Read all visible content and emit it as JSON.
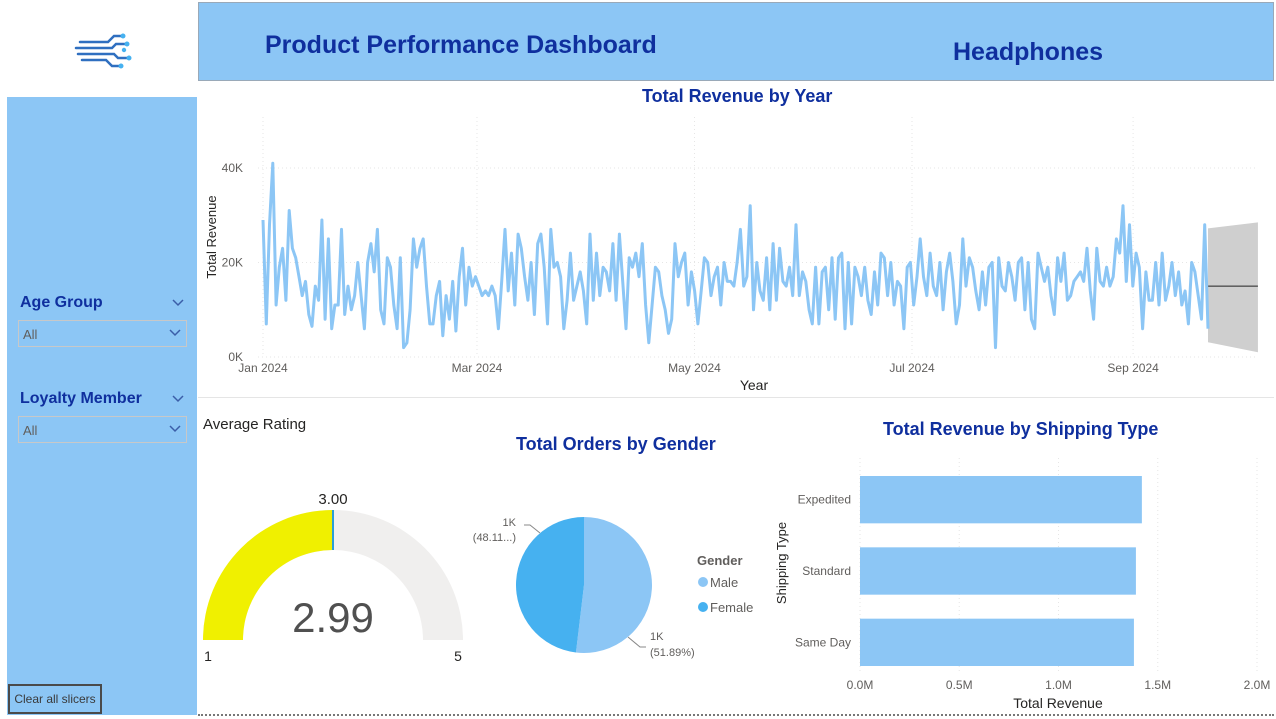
{
  "header": {
    "title": "Product Performance Dashboard",
    "product": "Headphones"
  },
  "slicers": [
    {
      "title": "Age Group",
      "value": "All"
    },
    {
      "title": "Loyalty Member",
      "value": "All"
    }
  ],
  "clear_button": "Clear all slicers",
  "colors": {
    "panel": "#8cc6f5",
    "title_text": "#0f2f9e",
    "line": "#8cc6f5",
    "male": "#8cc6f5",
    "female": "#46b1f0",
    "gauge_fill": "#f0f000",
    "gauge_track": "#f0efee",
    "bars": "#8cc6f5"
  },
  "gauge": {
    "title": "Average Rating",
    "value": 2.99,
    "value_label": "2.99",
    "target": 3.0,
    "target_label": "3.00",
    "min": 1,
    "max": 5,
    "min_label": "1",
    "max_label": "5"
  },
  "chart_data": [
    {
      "type": "line",
      "title": "Total Revenue by Year",
      "xlabel": "Year",
      "ylabel": "Total Revenue",
      "ylim": [
        0,
        40000
      ],
      "yticks": [
        "0K",
        "20K",
        "40K"
      ],
      "xticks": [
        "Jan 2024",
        "Mar 2024",
        "May 2024",
        "Jul 2024",
        "Sep 2024"
      ],
      "x_range": [
        "2024-01-01",
        "2024-09-22"
      ],
      "grid": true,
      "forecast": {
        "start": "2024-09-22",
        "end": "2024-10-06",
        "value": 15000,
        "upper": 28500,
        "lower": 1000
      },
      "series": [
        {
          "values": [
            29000,
            7000,
            28000,
            41000,
            11000,
            19000,
            23000,
            12000,
            31000,
            23000,
            21000,
            17000,
            13000,
            16000,
            9000,
            6500,
            15000,
            12000,
            29000,
            8000,
            25000,
            6000,
            11000,
            11000,
            27000,
            9000,
            15000,
            10000,
            13000,
            20000,
            13000,
            6000,
            20000,
            24000,
            18000,
            27000,
            10000,
            7000,
            21000,
            19000,
            11000,
            6000,
            21000,
            2000,
            3000,
            10000,
            25000,
            19000,
            23000,
            25000,
            15000,
            7000,
            7000,
            13000,
            16000,
            4500,
            13000,
            8000,
            16000,
            5500,
            17000,
            23000,
            11000,
            19000,
            15000,
            17000,
            15000,
            13000,
            14000,
            13000,
            15000,
            13000,
            6000,
            16000,
            27000,
            14000,
            22000,
            11000,
            26000,
            23000,
            17000,
            12000,
            20000,
            9000,
            24000,
            26000,
            19000,
            7000,
            27000,
            19000,
            20000,
            17000,
            6000,
            12000,
            22000,
            12000,
            15000,
            18000,
            14000,
            7000,
            26000,
            12000,
            22000,
            13000,
            19000,
            18000,
            14000,
            24000,
            12000,
            26000,
            16000,
            6000,
            21000,
            19000,
            22000,
            17000,
            24000,
            11000,
            3000,
            11000,
            19000,
            18000,
            13000,
            10000,
            5000,
            8000,
            24000,
            17000,
            20000,
            22000,
            11000,
            18000,
            14000,
            7000,
            14000,
            21000,
            20000,
            13000,
            17000,
            19000,
            11000,
            20000,
            16000,
            16000,
            15000,
            20000,
            27000,
            15000,
            17000,
            32000,
            10000,
            20000,
            14000,
            12000,
            21000,
            10000,
            24000,
            12000,
            23000,
            16000,
            15000,
            19000,
            13000,
            28000,
            13000,
            18000,
            16000,
            10000,
            7000,
            19000,
            7000,
            18000,
            19000,
            10000,
            21000,
            8000,
            21000,
            22000,
            6000,
            20000,
            7000,
            19000,
            17000,
            13000,
            19000,
            12000,
            9000,
            18000,
            11000,
            22000,
            21000,
            13000,
            20000,
            11000,
            16000,
            15000,
            6000,
            19000,
            20000,
            11000,
            17000,
            25000,
            17000,
            13000,
            22000,
            15000,
            13000,
            20000,
            10000,
            18000,
            22000,
            16000,
            7000,
            11000,
            25000,
            15000,
            21000,
            19000,
            14000,
            10000,
            18000,
            11000,
            19000,
            20000,
            2000,
            21000,
            15000,
            14000,
            20000,
            17000,
            12000,
            20000,
            21000,
            10000,
            20000,
            8000,
            6000,
            22000,
            19000,
            16000,
            19000,
            13000,
            9000,
            21000,
            16000,
            22000,
            12000,
            13000,
            16000,
            17000,
            18000,
            16000,
            23000,
            14000,
            8000,
            23000,
            16000,
            15000,
            19000,
            15000,
            17000,
            25000,
            22000,
            32000,
            16000,
            28000,
            15000,
            22000,
            19000,
            6000,
            18000,
            12000,
            12000,
            20000,
            11000,
            22000,
            12000,
            15000,
            20000,
            13000,
            18000,
            11000,
            14000,
            7000,
            20000,
            18000,
            13000,
            8000,
            28000,
            6000
          ]
        }
      ]
    },
    {
      "type": "pie",
      "title": "Total Orders by Gender",
      "legend_title": "Gender",
      "legend_position": "right",
      "series": [
        {
          "name": "Male",
          "value": 51.89,
          "label": "1K",
          "percent_label": "(51.89%)"
        },
        {
          "name": "Female",
          "value": 48.11,
          "label": "1K",
          "percent_label": "(48.11...)"
        }
      ]
    },
    {
      "type": "bar",
      "orientation": "horizontal",
      "title": "Total Revenue by Shipping Type",
      "xlabel": "Total Revenue",
      "ylabel": "Shipping Type",
      "categories": [
        "Expedited",
        "Standard",
        "Same Day"
      ],
      "values": [
        1420000,
        1390000,
        1380000
      ],
      "xlim": [
        0,
        2000000
      ],
      "xticks": [
        "0.0M",
        "0.5M",
        "1.0M",
        "1.5M",
        "2.0M"
      ],
      "grid": true
    }
  ]
}
